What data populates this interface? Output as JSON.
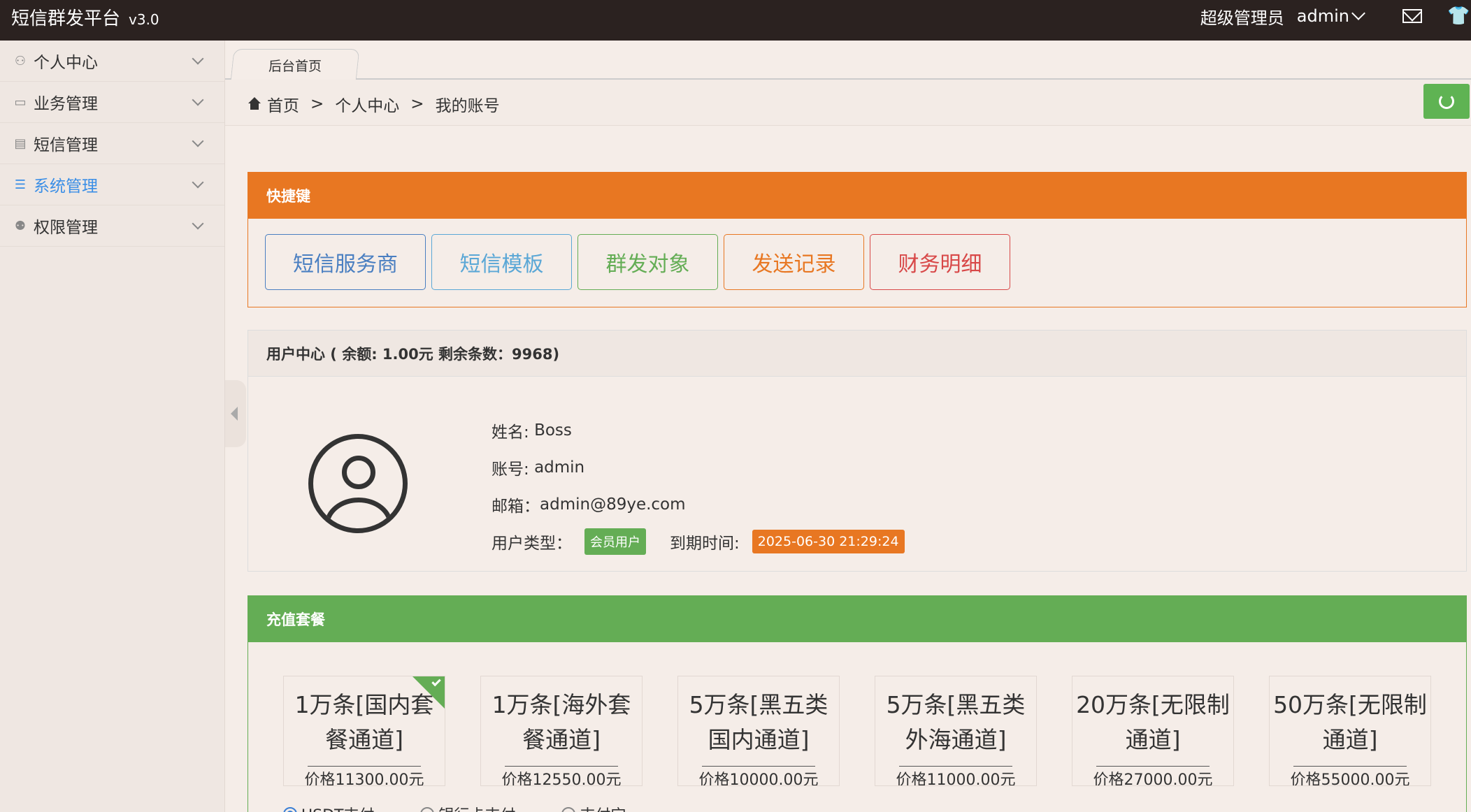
{
  "header": {
    "brand": "短信群发平台",
    "version": "v3.0",
    "role": "超级管理员",
    "username": "admin"
  },
  "sidebar": {
    "items": [
      {
        "label": "个人中心",
        "icon": "user-icon",
        "active": false
      },
      {
        "label": "业务管理",
        "icon": "card-icon",
        "active": false
      },
      {
        "label": "短信管理",
        "icon": "book-icon",
        "active": false
      },
      {
        "label": "系统管理",
        "icon": "database-icon",
        "active": true
      },
      {
        "label": "权限管理",
        "icon": "users-icon",
        "active": false
      }
    ]
  },
  "tabs": [
    {
      "label": "后台首页"
    }
  ],
  "breadcrumb": [
    "首页",
    "个人中心",
    "我的账号"
  ],
  "breadcrumb_sep": ">",
  "shortcut_panel": {
    "title": "快捷键",
    "buttons": [
      "短信服务商",
      "短信模板",
      "群发对象",
      "发送记录",
      "财务明细"
    ]
  },
  "user_panel": {
    "title": "用户中心 ( 余额: 1.00元 剩余条数：9968)",
    "name_label": "姓名: ",
    "name": "Boss",
    "account_label": "账号: ",
    "account": "admin",
    "email_label": "邮箱： ",
    "email": "admin@89ye.com",
    "type_label": "用户类型：",
    "type": "会员用户",
    "expire_label": "到期时间: ",
    "expire": "2025-06-30 21:29:24"
  },
  "package_panel": {
    "title": "充值套餐",
    "packages": [
      {
        "name": "1万条[国内套餐通道]",
        "price": "价格11300.00元",
        "selected": true
      },
      {
        "name": "1万条[海外套餐通道]",
        "price": "价格12550.00元",
        "selected": false
      },
      {
        "name": "5万条[黑五类国内通道]",
        "price": "价格10000.00元",
        "selected": false
      },
      {
        "name": "5万条[黑五类外海通道]",
        "price": "价格11000.00元",
        "selected": false
      },
      {
        "name": "20万条[无限制通道]",
        "price": "价格27000.00元",
        "selected": false
      },
      {
        "name": "50万条[无限制通道]",
        "price": "价格55000.00元",
        "selected": false
      }
    ],
    "payments": [
      "USDT支付",
      "银行卡支付",
      "支付宝"
    ],
    "selected_payment": "USDT支付"
  },
  "colors": {
    "topbar": "#2b2220",
    "orange": "#e87722",
    "green": "#64ad55",
    "blue": "#3a8ee6"
  }
}
